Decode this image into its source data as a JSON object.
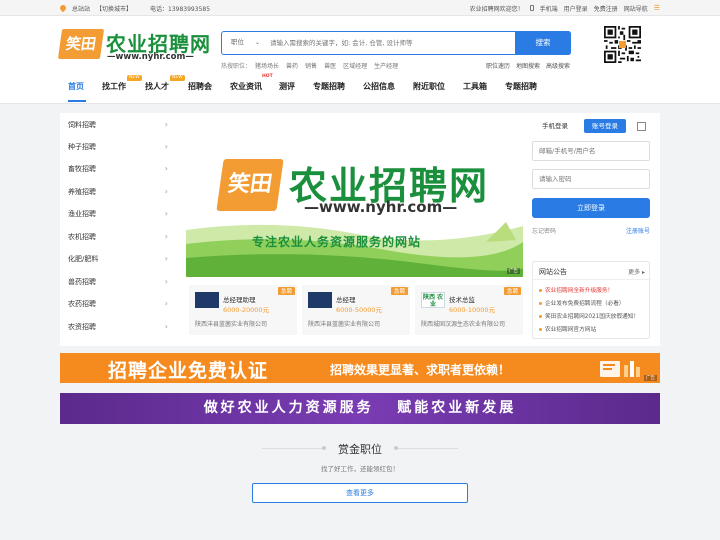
{
  "topbar": {
    "site_label": "总站站",
    "switch_city": "【切换城市】",
    "phone": "电话：13983993585",
    "welcome": "农业招聘网欢迎您！",
    "mobile": "手机端",
    "user_login": "用户登录",
    "free_register": "免费注册",
    "site_nav": "网站导航",
    "menu_glyph": "☰"
  },
  "logo": {
    "badge": "笑田",
    "cn": "农业招聘网",
    "url": "—www.nyhr.com—"
  },
  "search": {
    "category": "职位",
    "chevron": "⌄",
    "placeholder": "请输入需搜索的关键字，如: 会计, 仓管, 设计师等",
    "button": "搜索",
    "hot_label": "热搜职位：",
    "hot_words": [
      "猪场场长",
      "兽药",
      "销售",
      "兽医",
      "区域经理",
      "生产经理"
    ],
    "links": [
      "职位速历",
      "地图搜索",
      "高级搜索"
    ]
  },
  "nav": {
    "items": [
      {
        "label": "首页"
      },
      {
        "label": "找工作",
        "badge": "NEW"
      },
      {
        "label": "找人才",
        "badge": "NEW"
      },
      {
        "label": "招聘会"
      },
      {
        "label": "农业资讯"
      },
      {
        "label": "测评",
        "badge": "HOT"
      },
      {
        "label": "专题招聘"
      },
      {
        "label": "公招信息"
      },
      {
        "label": "附近职位"
      },
      {
        "label": "工具箱"
      },
      {
        "label": "专题招聘"
      }
    ]
  },
  "sidebar": {
    "arrow": "›",
    "items": [
      "饲料招聘",
      "种子招聘",
      "畜牧招聘",
      "养殖招聘",
      "渔业招聘",
      "农机招聘",
      "化肥/肥料",
      "兽药招聘",
      "农药招聘",
      "农资招聘"
    ]
  },
  "banner": {
    "badge": "笑田",
    "cn": "农业招聘网",
    "url": "—www.nyhr.com—",
    "tagline": "专注农业人务资源服务的网站",
    "ad_tag": "广告"
  },
  "jobs": [
    {
      "title": "总经理助理",
      "salary": "6000-20000元",
      "company": "陕西沣县蓝菌实业有限公司",
      "tag": "急聘",
      "logo_text": ""
    },
    {
      "title": "总经理",
      "salary": "6000-50000元",
      "company": "陕西沣县蓝菌实业有限公司",
      "tag": "急聘",
      "logo_text": ""
    },
    {
      "title": "技术总监",
      "salary": "6000-10000元",
      "company": "陕西城固汉源生态农业有限公司",
      "tag": "急聘",
      "logo_text": "陕西 农业"
    }
  ],
  "login": {
    "tab_mobile": "手机登录",
    "tab_account": "账号登录",
    "username_placeholder": "邮箱/手机号/用户名",
    "password_placeholder": "请输入密码",
    "submit": "立即登录",
    "forgot": "忘记密码",
    "register": "注册账号"
  },
  "notice": {
    "title": "网站公告",
    "more": "更多 ▸",
    "items": [
      {
        "text": "农业招聘网全新升级服务！",
        "highlight": true
      },
      {
        "text": "企业发布免费招聘流程（必看）",
        "highlight": false
      },
      {
        "text": "笑田农业招聘网2021国庆放假通知！",
        "highlight": false
      },
      {
        "text": "农业招聘网官方网站",
        "highlight": false
      }
    ]
  },
  "ads": {
    "ad1_main": "招聘企业免费认证",
    "ad1_sub": "招聘效果更显著、求职者更依赖！",
    "ad2": "做好农业人力资源服务   赋能农业新发展",
    "ad_tag": "广告"
  },
  "section": {
    "title": "赏金职位",
    "subtitle": "找了好工作，还能领红包！",
    "more_button": "查看更多"
  },
  "colors": {
    "brand_blue": "#2a7be4",
    "brand_orange": "#f39c33",
    "brand_green": "#1a8f3c"
  }
}
